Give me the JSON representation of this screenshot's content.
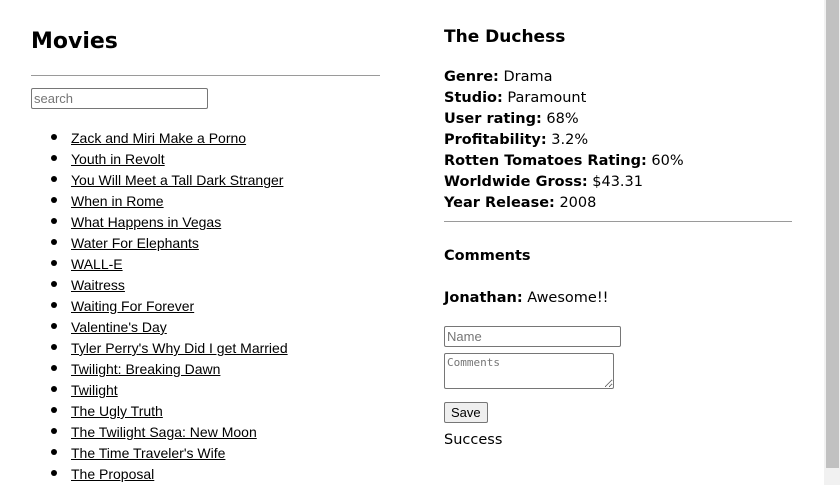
{
  "movies_panel": {
    "title": "Movies",
    "search_placeholder": "search",
    "movies": [
      "Zack and Miri Make a Porno",
      "Youth in Revolt",
      "You Will Meet a Tall Dark Stranger",
      "When in Rome",
      "What Happens in Vegas",
      "Water For Elephants",
      "WALL-E",
      "Waitress",
      "Waiting For Forever",
      "Valentine's Day",
      "Tyler Perry's Why Did I get Married",
      "Twilight: Breaking Dawn",
      "Twilight",
      "The Ugly Truth",
      "The Twilight Saga: New Moon",
      "The Time Traveler's Wife",
      "The Proposal"
    ]
  },
  "detail_panel": {
    "title": "The Duchess",
    "fields": [
      {
        "label": "Genre:",
        "value": "Drama"
      },
      {
        "label": "Studio:",
        "value": "Paramount"
      },
      {
        "label": "User rating:",
        "value": "68%"
      },
      {
        "label": "Profitability:",
        "value": "3.2%"
      },
      {
        "label": "Rotten Tomatoes Rating:",
        "value": "60%"
      },
      {
        "label": "Worldwide Gross:",
        "value": "$43.31"
      },
      {
        "label": "Year Release:",
        "value": "2008"
      }
    ]
  },
  "comments": {
    "title": "Comments",
    "items": [
      {
        "author": "Jonathan:",
        "text": "Awesome!!"
      }
    ],
    "name_placeholder": "Name",
    "comments_placeholder": "Comments",
    "save_label": "Save",
    "status": "Success"
  }
}
